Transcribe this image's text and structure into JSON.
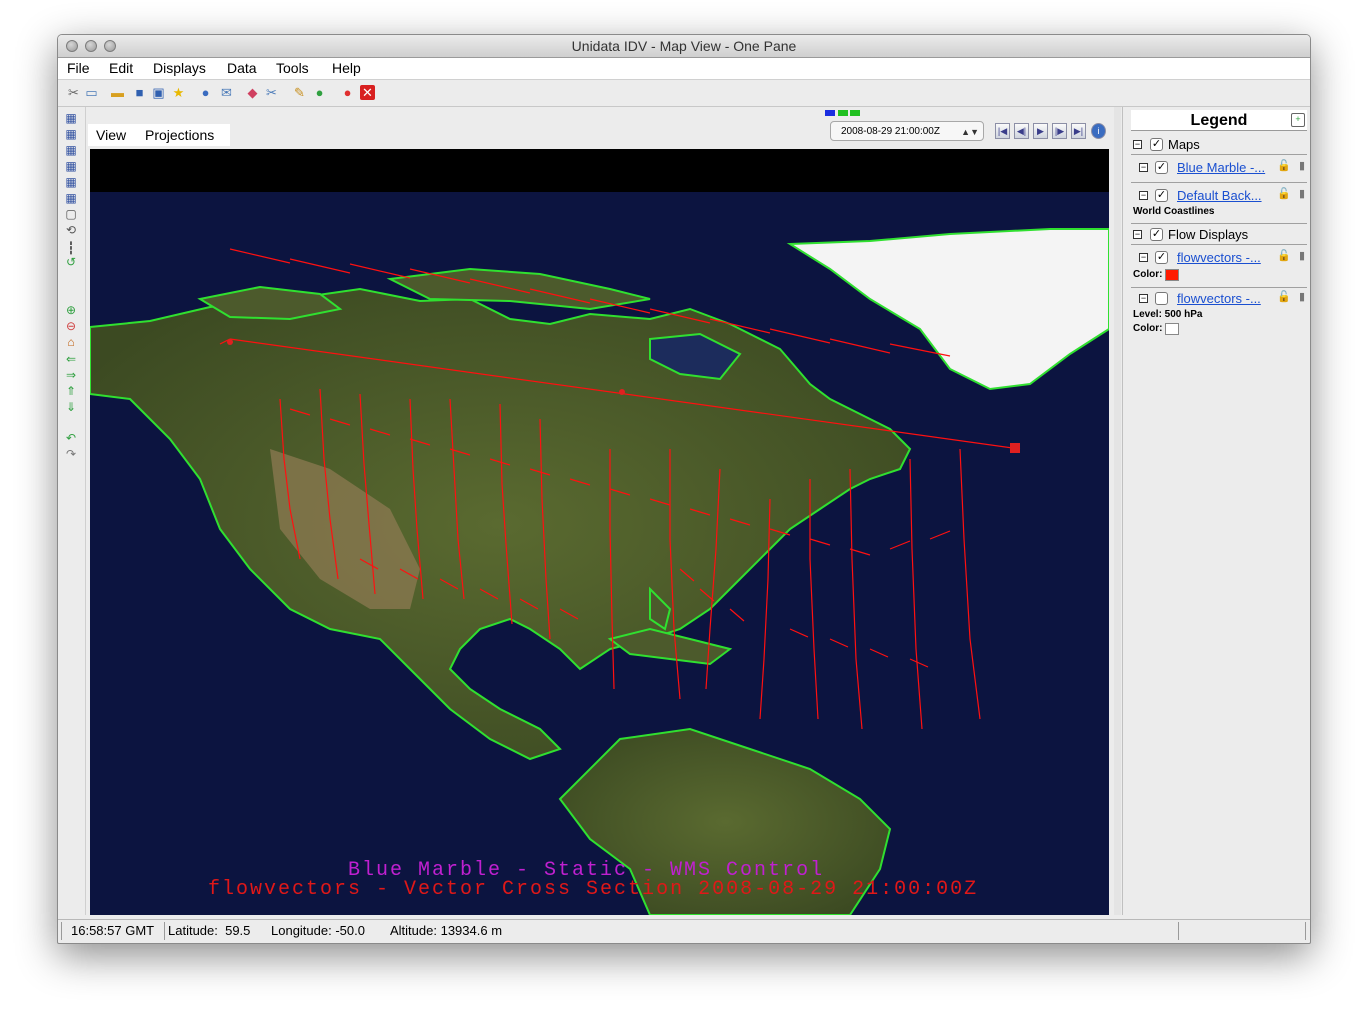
{
  "window": {
    "title": "Unidata IDV - Map View - One Pane"
  },
  "menubar": [
    "File",
    "Edit",
    "Displays",
    "Data",
    "Tools",
    "Help"
  ],
  "view_tabs": [
    "View",
    "Projections"
  ],
  "time_selector": {
    "value": "2008-08-29 21:00:00Z"
  },
  "map": {
    "overlay_line1": "Blue Marble - Static - WMS Control",
    "overlay_line2": "flowvectors - Vector Cross Section 2008-08-29 21:00:00Z",
    "line1_color": "#c020d0",
    "line2_color": "#e01818",
    "coastline_color": "#30e030",
    "vector_color": "#ff1010"
  },
  "legend": {
    "title": "Legend",
    "groups": [
      {
        "label": "Maps"
      },
      {
        "label": "Flow Displays"
      }
    ],
    "items": [
      {
        "link": "Blue Marble -...",
        "checked": true
      },
      {
        "link": "Default Back...",
        "checked": true,
        "sublabel": "World Coastlines"
      },
      {
        "link": "flowvectors -...",
        "checked": true,
        "color_label": "Color:",
        "color": "#ff1a00"
      },
      {
        "link": "flowvectors -...",
        "checked": false,
        "level_label": "Level: 500 hPa",
        "color_label": "Color:",
        "color": "#ffffff"
      }
    ]
  },
  "status": {
    "time": "16:58:57 GMT",
    "latitude": "Latitude:  59.5",
    "longitude": "Longitude: -50.0",
    "altitude": "Altitude: 13934.6 m"
  }
}
